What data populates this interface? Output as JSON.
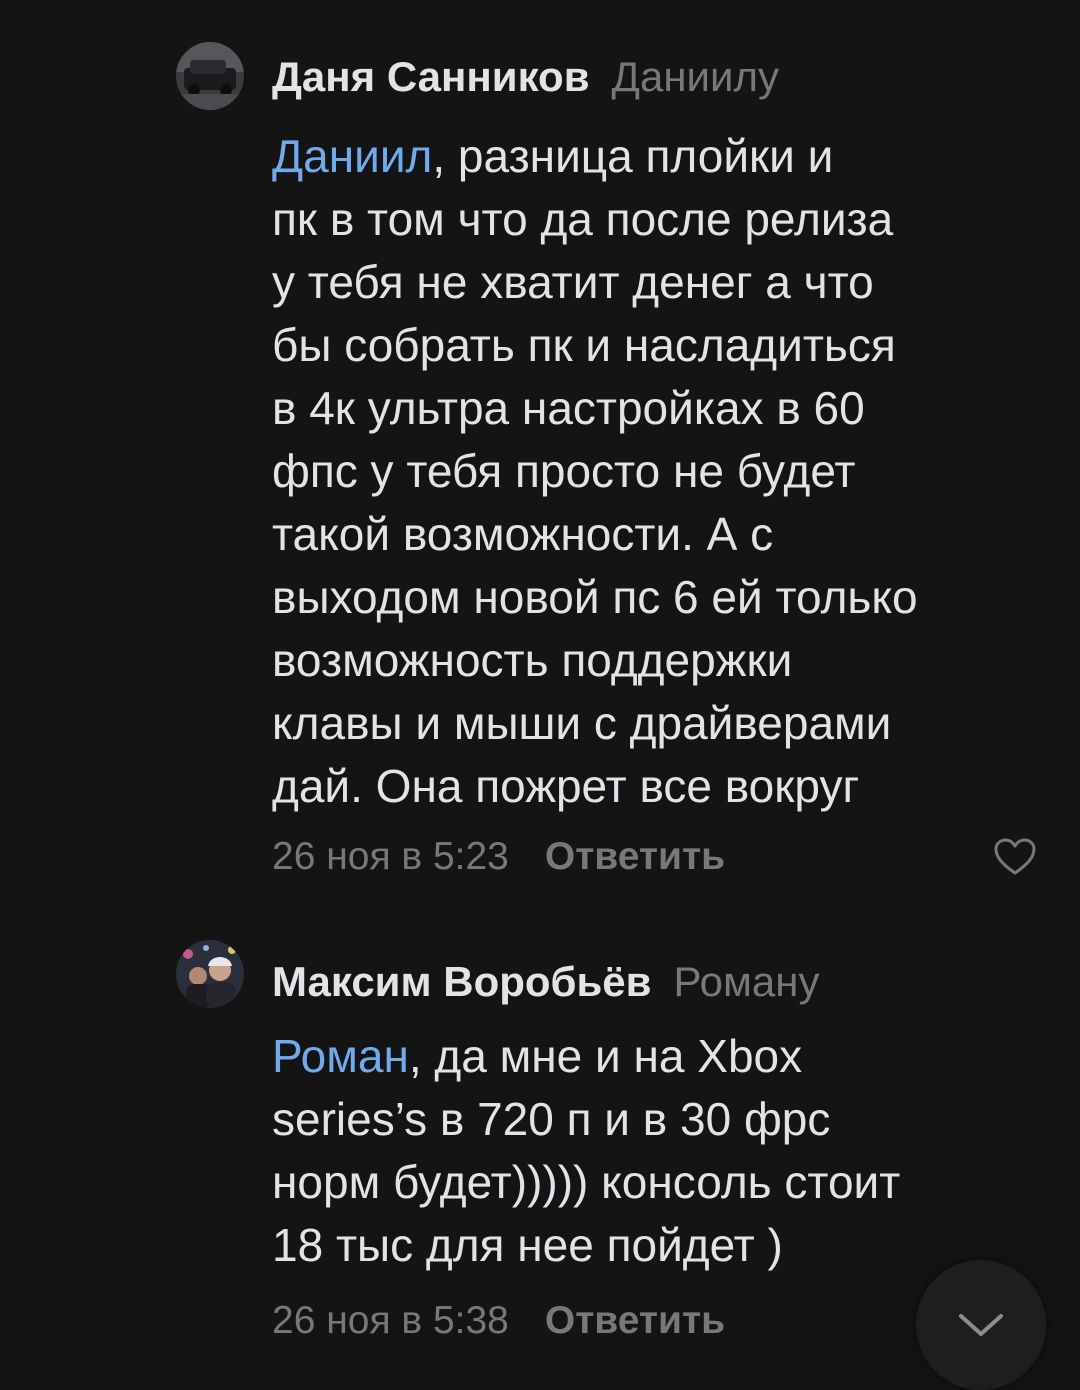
{
  "comments": [
    {
      "author": "Даня Санников",
      "reply_to": "Даниилу",
      "mention": "Даниил",
      "text": ", разница плойки и\nпк в том что да после релиза\nу тебя не хватит денег а что\nбы собрать пк и насладиться\nв 4к ультра настройках в 60\nфпс  у тебя просто не будет\nтакой возможности. А с\nвыходом новой пс 6 ей только\nвозможность поддержки\nклавы и мыши с драйверами\nдай. Она пожрет все вокруг",
      "timestamp": "26 ноя в 5:23",
      "reply_label": "Ответить",
      "like_icon": "heart-outline-icon"
    },
    {
      "author": "Максим Воробьёв",
      "reply_to": "Роману",
      "mention": "Роман",
      "text": ", да мне и на Xbox\nseries’s в 720 п и в 30 фрс\nнорм будет))))) консоль стоит\n18 тыс для нее пойдет )",
      "timestamp": "26 ноя в 5:38",
      "reply_label": "Ответить"
    }
  ],
  "scroll_button": {
    "icon": "chevron-down-icon"
  },
  "colors": {
    "background": "#141414",
    "text": "#e1e3e6",
    "secondary": "#76787a",
    "mention": "#71aaeb"
  }
}
